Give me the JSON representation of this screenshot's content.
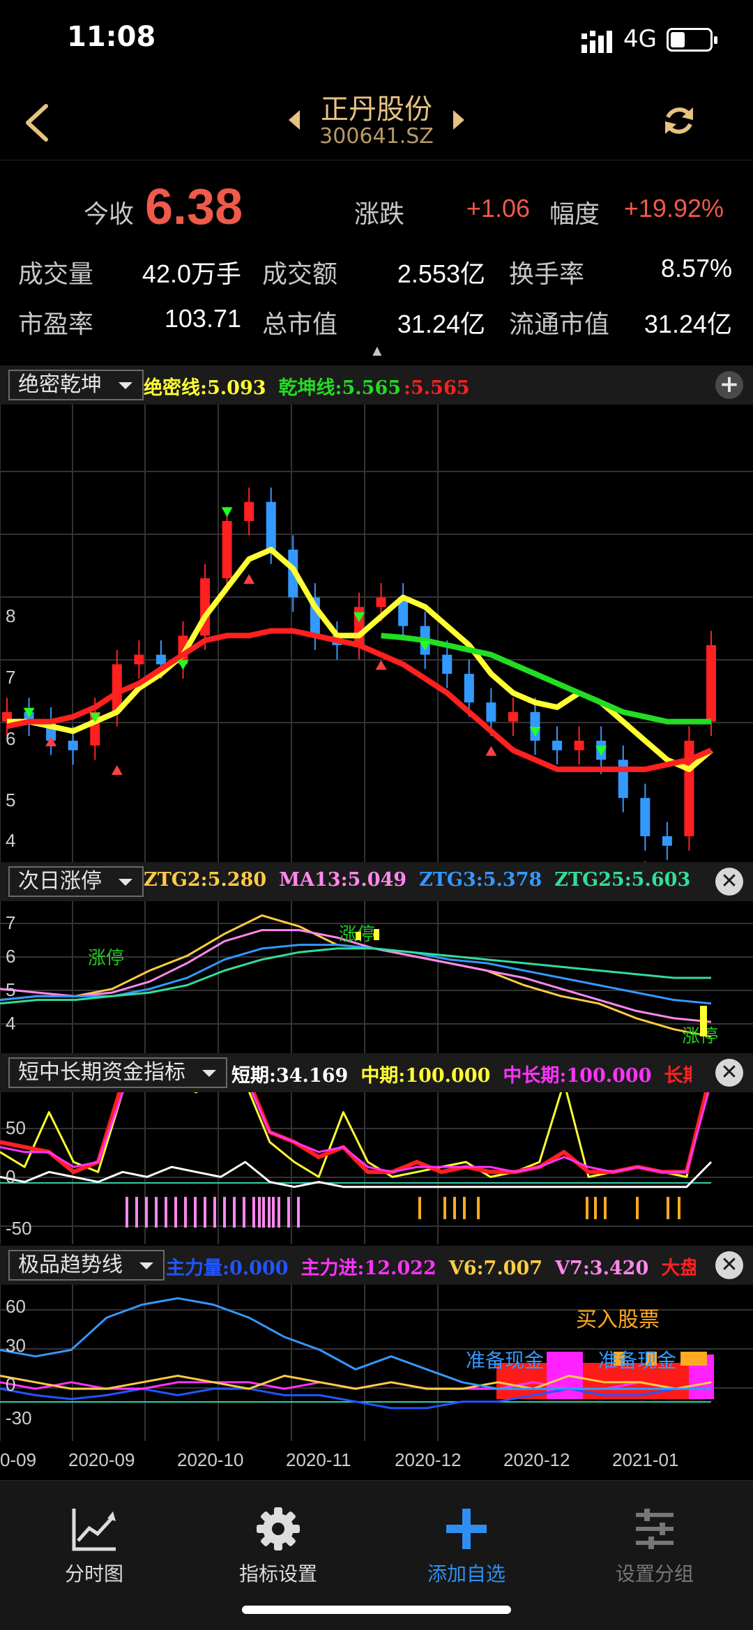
{
  "status_bar": {
    "time": "11:08",
    "network": "4G"
  },
  "header": {
    "stock_name": "正丹股份",
    "stock_code": "300641.SZ"
  },
  "quote": {
    "close_label": "今收",
    "close_price": "6.38",
    "change_label": "涨跌",
    "change_value": "+1.06",
    "pct_label": "幅度",
    "pct_value": "+19.92%",
    "volume_label": "成交量",
    "volume_value": "42.0万手",
    "amount_label": "成交额",
    "amount_value": "2.553亿",
    "turnover_label": "换手率",
    "turnover_value": "8.57%",
    "pe_label": "市盈率",
    "pe_value": "103.71",
    "mcap_label": "总市值",
    "mcap_value": "31.24亿",
    "float_label": "流通市值",
    "float_value": "31.24亿",
    "collapse_icon": "caret-up-icon"
  },
  "indicators": {
    "main": {
      "name": "绝密乾坤",
      "v1": "绝密线:5.093",
      "v2": "乾坤线:5.565",
      "v3": ":5.565"
    },
    "second": {
      "name": "次日涨停",
      "v1": "ZTG2:5.280",
      "v2": "MA13:5.049",
      "v3": "ZTG3:5.378",
      "v4": "ZTG25:5.603"
    },
    "third": {
      "name": "短中长期资金指标",
      "v1": "短期:34.169",
      "v2": "中期:100.000",
      "v3": "中长期:100.000",
      "v4": "长期:"
    },
    "fourth": {
      "name": "极品趋势线",
      "v1": "主力量:0.000",
      "v2": "主力进:12.022",
      "v3": "V6:7.007",
      "v4": "V7:3.420",
      "v5": "大盘资"
    }
  },
  "chart_labels": {
    "main_y_ticks": [
      "8",
      "7",
      "6",
      "5",
      "4"
    ],
    "second_y_ticks": [
      "7",
      "6",
      "5",
      "4"
    ],
    "third_y_ticks": [
      "50",
      "0",
      "-50"
    ],
    "fourth_y_ticks": [
      "60",
      "30",
      "0",
      "-30"
    ],
    "zt_labels": [
      "涨停",
      "涨停",
      "涨停"
    ],
    "fourth_texts": [
      "买入股票",
      "准备现金",
      "准备现金"
    ],
    "x_ticks": [
      "0-09",
      "2020-09",
      "2020-10",
      "2020-11",
      "2020-12",
      "2020-12",
      "2021-01"
    ]
  },
  "chart_data": [
    {
      "type": "candlestick",
      "ylim": [
        4,
        8.6
      ],
      "series": [
        {
          "name": "绝密线",
          "color": "#ffff33",
          "values": [
            5.5,
            5.5,
            5.45,
            5.4,
            5.5,
            5.6,
            5.85,
            6.0,
            6.2,
            6.6,
            6.9,
            7.2,
            7.3,
            7.1,
            6.7,
            6.4,
            6.4,
            6.6,
            6.8,
            6.7,
            6.5,
            6.3,
            6.0,
            5.8,
            5.7,
            5.65,
            5.8,
            5.7,
            5.5,
            5.3,
            5.1,
            5.0,
            5.2
          ]
        },
        {
          "name": "乾坤线",
          "color": "#ff2020",
          "values": [
            5.45,
            5.5,
            5.5,
            5.55,
            5.65,
            5.8,
            5.9,
            6.05,
            6.2,
            6.35,
            6.4,
            6.4,
            6.45,
            6.45,
            6.4,
            6.35,
            6.3,
            6.2,
            6.1,
            5.95,
            5.8,
            5.6,
            5.4,
            5.2,
            5.1,
            5.0,
            5.0,
            5.0,
            5.0,
            5.0,
            5.05,
            5.1,
            5.2
          ]
        },
        {
          "name": "乾坤线-green",
          "color": "#22dd22",
          "values": [
            null,
            null,
            null,
            null,
            null,
            null,
            null,
            null,
            null,
            null,
            null,
            null,
            null,
            null,
            null,
            null,
            null,
            6.4,
            6.38,
            6.35,
            6.3,
            6.25,
            6.2,
            6.1,
            6.0,
            5.9,
            5.8,
            5.7,
            5.6,
            5.55,
            5.5,
            5.5,
            5.5
          ]
        }
      ],
      "candles": [
        {
          "o": 5.5,
          "c": 5.6
        },
        {
          "o": 5.6,
          "c": 5.5
        },
        {
          "o": 5.5,
          "c": 5.3
        },
        {
          "o": 5.3,
          "c": 5.2
        },
        {
          "o": 5.25,
          "c": 5.6
        },
        {
          "o": 5.6,
          "c": 6.1
        },
        {
          "o": 6.1,
          "c": 6.2
        },
        {
          "o": 6.2,
          "c": 6.1
        },
        {
          "o": 6.1,
          "c": 6.4
        },
        {
          "o": 6.4,
          "c": 7.0
        },
        {
          "o": 7.0,
          "c": 7.6
        },
        {
          "o": 7.6,
          "c": 7.8
        },
        {
          "o": 7.8,
          "c": 7.3
        },
        {
          "o": 7.3,
          "c": 6.8
        },
        {
          "o": 6.8,
          "c": 6.4
        },
        {
          "o": 6.4,
          "c": 6.3
        },
        {
          "o": 6.3,
          "c": 6.7
        },
        {
          "o": 6.7,
          "c": 6.8
        },
        {
          "o": 6.8,
          "c": 6.5
        },
        {
          "o": 6.5,
          "c": 6.2
        },
        {
          "o": 6.2,
          "c": 6.0
        },
        {
          "o": 6.0,
          "c": 5.7
        },
        {
          "o": 5.7,
          "c": 5.5
        },
        {
          "o": 5.5,
          "c": 5.6
        },
        {
          "o": 5.6,
          "c": 5.3
        },
        {
          "o": 5.3,
          "c": 5.2
        },
        {
          "o": 5.2,
          "c": 5.3
        },
        {
          "o": 5.3,
          "c": 5.1
        },
        {
          "o": 5.1,
          "c": 4.7
        },
        {
          "o": 4.7,
          "c": 4.3
        },
        {
          "o": 4.3,
          "c": 4.2
        },
        {
          "o": 4.3,
          "c": 5.3
        },
        {
          "o": 5.5,
          "c": 6.3
        }
      ]
    },
    {
      "type": "line",
      "ylim": [
        3.7,
        7.5
      ],
      "series": [
        {
          "name": "ZTG2",
          "color": "#ffcc44",
          "values": [
            5.0,
            5.1,
            5.1,
            5.3,
            5.8,
            6.2,
            6.8,
            7.3,
            7.0,
            6.5,
            6.4,
            6.2,
            6.0,
            5.8,
            5.4,
            5.1,
            4.9,
            4.5,
            4.2,
            4.0
          ]
        },
        {
          "name": "MA13",
          "color": "#ff88ee",
          "values": [
            5.3,
            5.2,
            5.1,
            5.2,
            5.5,
            6.0,
            6.6,
            6.9,
            6.9,
            6.7,
            6.4,
            6.2,
            6.0,
            5.8,
            5.6,
            5.3,
            5.0,
            4.7,
            4.5,
            4.4
          ]
        },
        {
          "name": "ZTG3",
          "color": "#3399ff",
          "values": [
            5.0,
            5.1,
            5.1,
            5.1,
            5.3,
            5.6,
            6.1,
            6.4,
            6.5,
            6.5,
            6.4,
            6.3,
            6.1,
            6.0,
            5.8,
            5.6,
            5.4,
            5.2,
            5.0,
            4.9
          ]
        },
        {
          "name": "ZTG25",
          "color": "#33dd99",
          "values": [
            4.9,
            5.0,
            5.0,
            5.1,
            5.2,
            5.4,
            5.8,
            6.1,
            6.3,
            6.4,
            6.4,
            6.3,
            6.2,
            6.1,
            6.0,
            5.9,
            5.8,
            5.7,
            5.6,
            5.6
          ]
        }
      ]
    },
    {
      "type": "line",
      "ylim": [
        -60,
        80
      ],
      "series": [
        {
          "name": "短期",
          "color": "#ffff33",
          "values": [
            20,
            5,
            60,
            10,
            0,
            80,
            100,
            90,
            80,
            100,
            90,
            30,
            10,
            -5,
            60,
            10,
            -5,
            0,
            5,
            10,
            -5,
            0,
            10,
            90,
            -5,
            0,
            5,
            0,
            -5,
            100
          ]
        },
        {
          "name": "中期",
          "color": "#ff2020",
          "values": [
            30,
            25,
            20,
            0,
            10,
            90,
            100,
            95,
            100,
            100,
            100,
            40,
            30,
            15,
            25,
            0,
            0,
            10,
            0,
            5,
            0,
            0,
            5,
            20,
            0,
            0,
            5,
            0,
            0,
            100
          ]
        },
        {
          "name": "中长期",
          "color": "#ff33ff",
          "values": [
            25,
            20,
            20,
            5,
            10,
            80,
            95,
            100,
            95,
            100,
            95,
            40,
            30,
            20,
            25,
            5,
            0,
            5,
            5,
            5,
            5,
            0,
            5,
            15,
            5,
            0,
            5,
            0,
            0,
            90
          ]
        },
        {
          "name": "长期",
          "color": "#ffffff",
          "values": [
            -5,
            -10,
            0,
            -5,
            -10,
            0,
            -5,
            5,
            0,
            -5,
            10,
            -10,
            -15,
            -10,
            -15,
            -15,
            -15,
            -15,
            -15,
            -15,
            -15,
            -15,
            -15,
            -15,
            -15,
            -15,
            -15,
            -15,
            -15,
            10
          ]
        }
      ]
    },
    {
      "type": "line",
      "ylim": [
        -35,
        75
      ],
      "series": [
        {
          "name": "主力量",
          "color": "#2255ff",
          "values": [
            0,
            -5,
            -8,
            -5,
            0,
            -5,
            0,
            0,
            -5,
            -5,
            -10,
            -15,
            -15,
            -10,
            -10,
            -5,
            0,
            -5,
            -5,
            0,
            0
          ]
        },
        {
          "name": "主力进",
          "color": "#ff33ff",
          "values": [
            5,
            0,
            5,
            0,
            0,
            5,
            5,
            5,
            0,
            5,
            0,
            5,
            0,
            0,
            0,
            5,
            0,
            0,
            5,
            0,
            5
          ]
        },
        {
          "name": "V6",
          "color": "#ffcc44",
          "values": [
            10,
            5,
            0,
            0,
            5,
            10,
            5,
            0,
            10,
            5,
            0,
            5,
            0,
            0,
            5,
            0,
            10,
            5,
            5,
            0,
            5
          ]
        },
        {
          "name": "V7",
          "color": "#3399ff",
          "values": [
            30,
            25,
            30,
            55,
            65,
            70,
            65,
            55,
            40,
            30,
            15,
            25,
            15,
            5,
            0,
            0,
            0,
            0,
            0,
            0,
            0
          ]
        }
      ]
    }
  ]
}
